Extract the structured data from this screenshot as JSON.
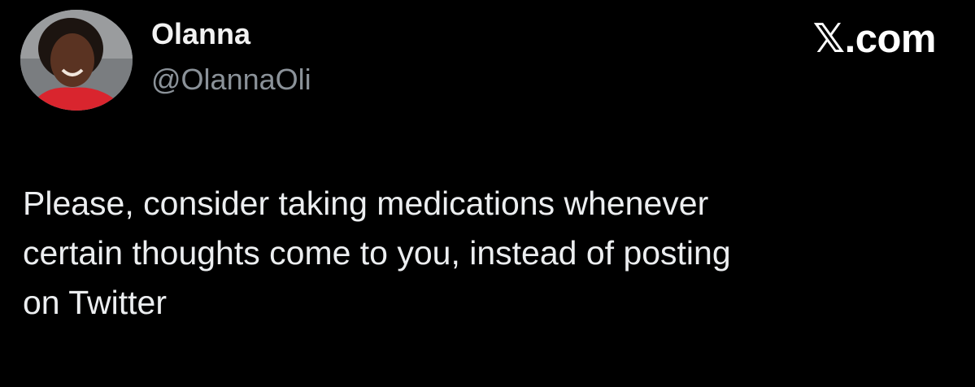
{
  "user": {
    "display_name": "Olanna",
    "handle": "@OlannaOli"
  },
  "brand": {
    "label": "𝕏.com"
  },
  "tweet": {
    "text": "Please, consider taking medications whenever\ncertain thoughts come to you, instead of posting\non Twitter"
  },
  "colors": {
    "background": "#000000",
    "text_primary": "#e7e9ea",
    "text_secondary": "#8b9299",
    "avatar_accent": "#d9252e"
  },
  "icons": {
    "avatar": "profile-photo"
  }
}
